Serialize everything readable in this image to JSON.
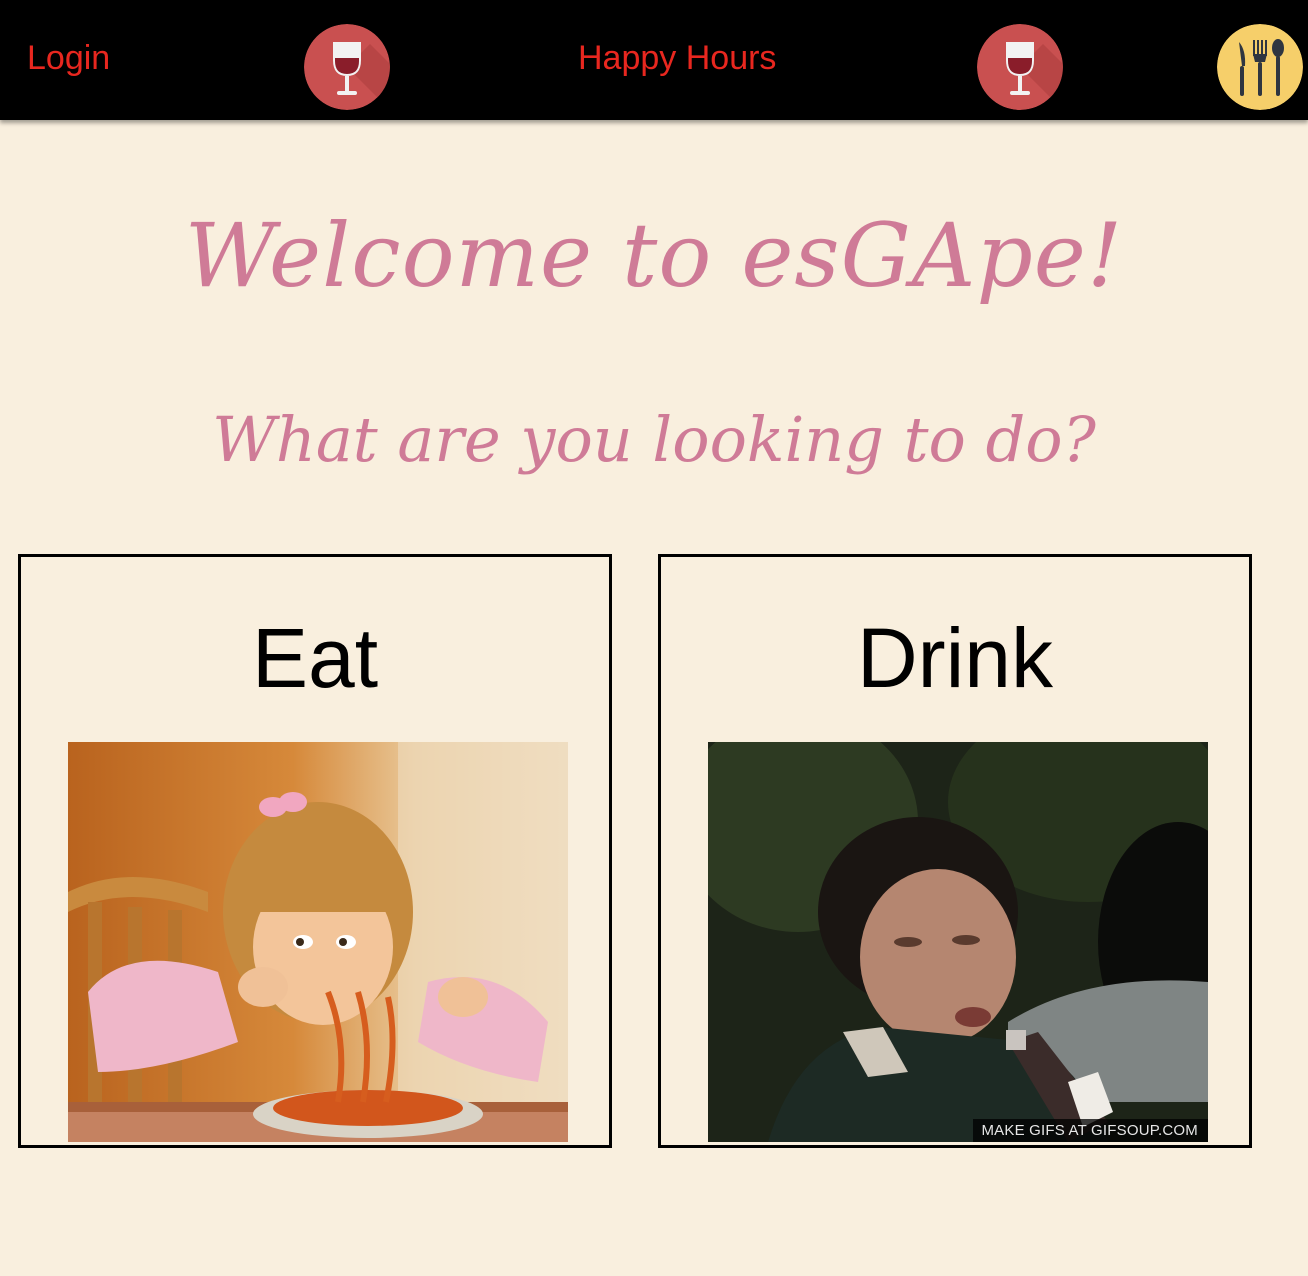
{
  "navbar": {
    "login_label": "Login",
    "happy_hours_label": "Happy Hours",
    "icons": [
      "wine-glass-icon",
      "wine-glass-icon",
      "cutlery-icon"
    ],
    "colors": {
      "background": "#000000",
      "link": "#e8271f",
      "wine_badge": "#c95050",
      "cutlery_badge": "#f6cf6a"
    }
  },
  "hero": {
    "title": "Welcome to esGApe!",
    "subtitle": "What are you looking to do?",
    "color": "#cf7b97"
  },
  "choices": [
    {
      "label": "Eat",
      "image": "girl-eating-spaghetti-gif"
    },
    {
      "label": "Drink",
      "image": "man-drinking-bottle-gif",
      "watermark": "MAKE GIFS AT GIFSOUP.COM"
    }
  ],
  "page": {
    "background": "#f9efde"
  }
}
